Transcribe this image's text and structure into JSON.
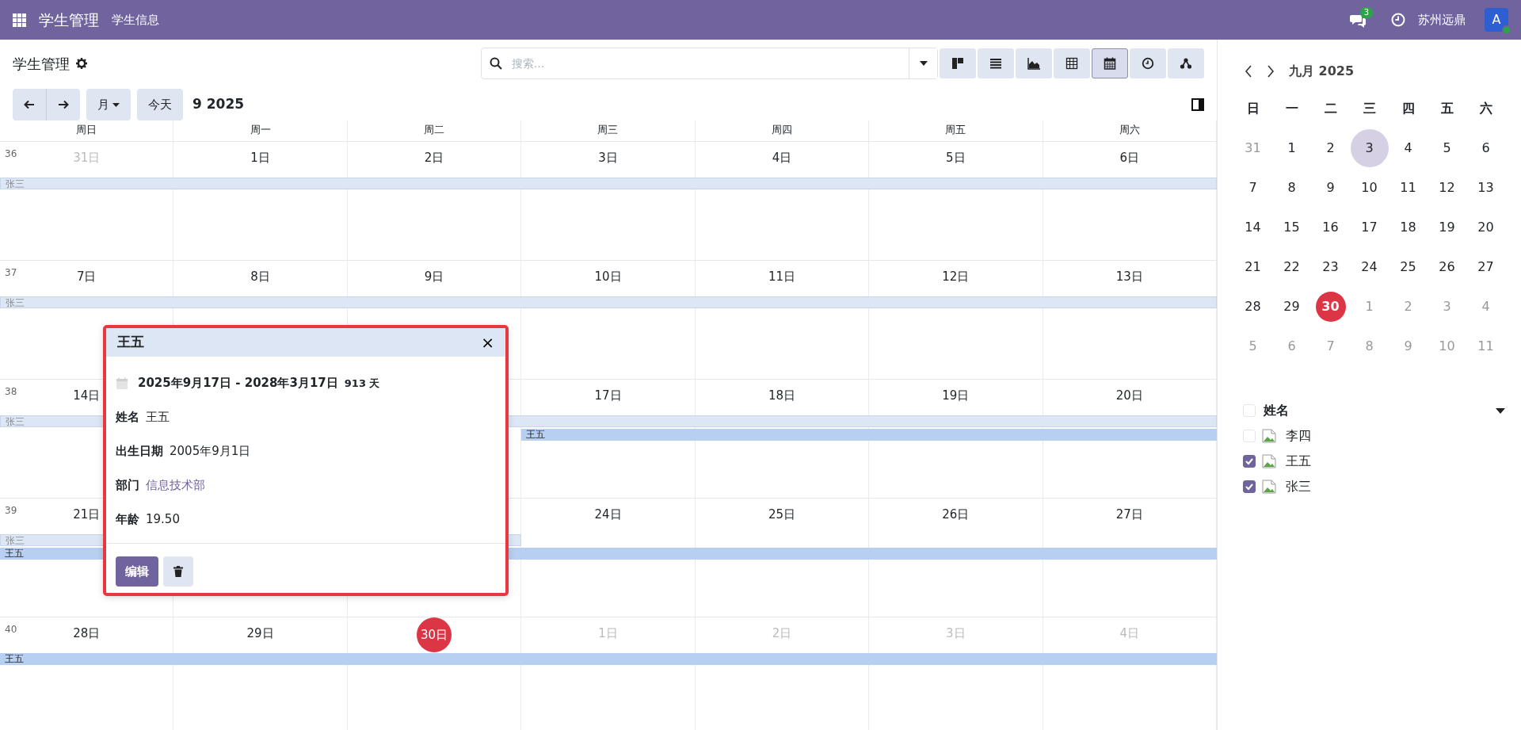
{
  "navbar": {
    "brand": "学生管理",
    "menu": [
      "学生信息"
    ],
    "messages_badge": "3",
    "company": "苏州远鼎",
    "avatar": "A"
  },
  "control_panel": {
    "title": "学生管理",
    "search": {
      "placeholder": "搜索..."
    },
    "views": [
      {
        "kind": "kanban",
        "selected": false
      },
      {
        "kind": "list",
        "selected": false
      },
      {
        "kind": "graph",
        "selected": false
      },
      {
        "kind": "pivot",
        "selected": false
      },
      {
        "kind": "calendar",
        "selected": true
      },
      {
        "kind": "activity",
        "selected": false
      },
      {
        "kind": "hierarchy",
        "selected": false
      }
    ]
  },
  "toolbar": {
    "scale": "月",
    "today": "今天",
    "period": "9 2025"
  },
  "calendar": {
    "weekdays": [
      "周日",
      "周一",
      "周二",
      "周三",
      "周四",
      "周五",
      "周六"
    ],
    "weeks": [
      {
        "number": "36",
        "days": [
          {
            "label": "31日",
            "muted": true,
            "today": false
          },
          {
            "label": "1日",
            "muted": false,
            "today": false
          },
          {
            "label": "2日",
            "muted": false,
            "today": false
          },
          {
            "label": "3日",
            "muted": false,
            "today": false
          },
          {
            "label": "4日",
            "muted": false,
            "today": false
          },
          {
            "label": "5日",
            "muted": false,
            "today": false
          },
          {
            "label": "6日",
            "muted": false,
            "today": false
          }
        ],
        "events": [
          {
            "label": "张三",
            "faded": true
          }
        ]
      },
      {
        "number": "37",
        "days": [
          {
            "label": "7日",
            "muted": false,
            "today": false
          },
          {
            "label": "8日",
            "muted": false,
            "today": false
          },
          {
            "label": "9日",
            "muted": false,
            "today": false
          },
          {
            "label": "10日",
            "muted": false,
            "today": false
          },
          {
            "label": "11日",
            "muted": false,
            "today": false
          },
          {
            "label": "12日",
            "muted": false,
            "today": false
          },
          {
            "label": "13日",
            "muted": false,
            "today": false
          }
        ],
        "events": [
          {
            "label": "张三",
            "faded": true
          }
        ]
      },
      {
        "number": "38",
        "days": [
          {
            "label": "14日",
            "muted": false,
            "today": false
          },
          {
            "label": "17日",
            "muted": false,
            "today": false
          },
          {
            "label": "18日",
            "muted": false,
            "today": false
          },
          {
            "label": "19日",
            "muted": false,
            "today": false
          },
          {
            "label": "20日",
            "muted": false,
            "today": false
          }
        ],
        "events": [
          {
            "label": "张三",
            "faded": true
          },
          {
            "label": "王五",
            "faded": false
          }
        ]
      },
      {
        "number": "39",
        "days": [
          {
            "label": "21日",
            "muted": false,
            "today": false
          },
          {
            "label": "24日",
            "muted": false,
            "today": false
          },
          {
            "label": "25日",
            "muted": false,
            "today": false
          },
          {
            "label": "26日",
            "muted": false,
            "today": false
          },
          {
            "label": "27日",
            "muted": false,
            "today": false
          }
        ],
        "events": [
          {
            "label": "张三",
            "faded": true
          },
          {
            "label": "王五",
            "faded": false
          }
        ]
      },
      {
        "number": "40",
        "days": [
          {
            "label": "28日",
            "muted": false,
            "today": false
          },
          {
            "label": "29日",
            "muted": false,
            "today": false
          },
          {
            "label": "30日",
            "muted": false,
            "today": true
          },
          {
            "label": "1日",
            "muted": true,
            "today": false
          },
          {
            "label": "2日",
            "muted": true,
            "today": false
          },
          {
            "label": "3日",
            "muted": true,
            "today": false
          },
          {
            "label": "4日",
            "muted": true,
            "today": false
          }
        ],
        "events": [
          {
            "label": "王五",
            "faded": false
          }
        ]
      }
    ]
  },
  "popover": {
    "title": "王五",
    "close": "×",
    "date_range": "2025年9月17日 - 2028年3月17日",
    "duration": "913 天",
    "fields": [
      {
        "label": "姓名",
        "value": "王五",
        "kind": "text"
      },
      {
        "label": "出生日期",
        "value": "2005年9月1日",
        "kind": "text"
      },
      {
        "label": "部门",
        "value": "信息技术部",
        "kind": "link"
      },
      {
        "label": "年龄",
        "value": "19.50",
        "kind": "text"
      }
    ],
    "edit": "编辑"
  },
  "sidebar": {
    "month": "九月 2025",
    "weekdays": [
      "日",
      "一",
      "二",
      "三",
      "四",
      "五",
      "六"
    ],
    "weeks": [
      [
        {
          "label": "31",
          "muted": true,
          "selected": false,
          "today": false
        },
        {
          "label": "1",
          "muted": false,
          "selected": false,
          "today": false
        },
        {
          "label": "2",
          "muted": false,
          "selected": false,
          "today": false
        },
        {
          "label": "3",
          "muted": false,
          "selected": true,
          "today": false
        },
        {
          "label": "4",
          "muted": false,
          "selected": false,
          "today": false
        },
        {
          "label": "5",
          "muted": false,
          "selected": false,
          "today": false
        },
        {
          "label": "6",
          "muted": false,
          "selected": false,
          "today": false
        }
      ],
      [
        {
          "label": "7",
          "muted": false,
          "selected": false,
          "today": false
        },
        {
          "label": "8",
          "muted": false,
          "selected": false,
          "today": false
        },
        {
          "label": "9",
          "muted": false,
          "selected": false,
          "today": false
        },
        {
          "label": "10",
          "muted": false,
          "selected": false,
          "today": false
        },
        {
          "label": "11",
          "muted": false,
          "selected": false,
          "today": false
        },
        {
          "label": "12",
          "muted": false,
          "selected": false,
          "today": false
        },
        {
          "label": "13",
          "muted": false,
          "selected": false,
          "today": false
        }
      ],
      [
        {
          "label": "14",
          "muted": false,
          "selected": false,
          "today": false
        },
        {
          "label": "15",
          "muted": false,
          "selected": false,
          "today": false
        },
        {
          "label": "16",
          "muted": false,
          "selected": false,
          "today": false
        },
        {
          "label": "17",
          "muted": false,
          "selected": false,
          "today": false
        },
        {
          "label": "18",
          "muted": false,
          "selected": false,
          "today": false
        },
        {
          "label": "19",
          "muted": false,
          "selected": false,
          "today": false
        },
        {
          "label": "20",
          "muted": false,
          "selected": false,
          "today": false
        }
      ],
      [
        {
          "label": "21",
          "muted": false,
          "selected": false,
          "today": false
        },
        {
          "label": "22",
          "muted": false,
          "selected": false,
          "today": false
        },
        {
          "label": "23",
          "muted": false,
          "selected": false,
          "today": false
        },
        {
          "label": "24",
          "muted": false,
          "selected": false,
          "today": false
        },
        {
          "label": "25",
          "muted": false,
          "selected": false,
          "today": false
        },
        {
          "label": "26",
          "muted": false,
          "selected": false,
          "today": false
        },
        {
          "label": "27",
          "muted": false,
          "selected": false,
          "today": false
        }
      ],
      [
        {
          "label": "28",
          "muted": false,
          "selected": false,
          "today": false
        },
        {
          "label": "29",
          "muted": false,
          "selected": false,
          "today": false
        },
        {
          "label": "30",
          "muted": false,
          "selected": false,
          "today": true
        },
        {
          "label": "1",
          "muted": true,
          "selected": false,
          "today": false
        },
        {
          "label": "2",
          "muted": true,
          "selected": false,
          "today": false
        },
        {
          "label": "3",
          "muted": true,
          "selected": false,
          "today": false
        },
        {
          "label": "4",
          "muted": true,
          "selected": false,
          "today": false
        }
      ],
      [
        {
          "label": "5",
          "muted": true,
          "selected": false,
          "today": false
        },
        {
          "label": "6",
          "muted": true,
          "selected": false,
          "today": false
        },
        {
          "label": "7",
          "muted": true,
          "selected": false,
          "today": false
        },
        {
          "label": "8",
          "muted": true,
          "selected": false,
          "today": false
        },
        {
          "label": "9",
          "muted": true,
          "selected": false,
          "today": false
        },
        {
          "label": "10",
          "muted": true,
          "selected": false,
          "today": false
        },
        {
          "label": "11",
          "muted": true,
          "selected": false,
          "today": false
        }
      ]
    ],
    "filter": {
      "title": "姓名",
      "checked": false,
      "items": [
        {
          "label": "李四",
          "checked": false
        },
        {
          "label": "王五",
          "checked": true
        },
        {
          "label": "张三",
          "checked": true
        }
      ]
    }
  }
}
